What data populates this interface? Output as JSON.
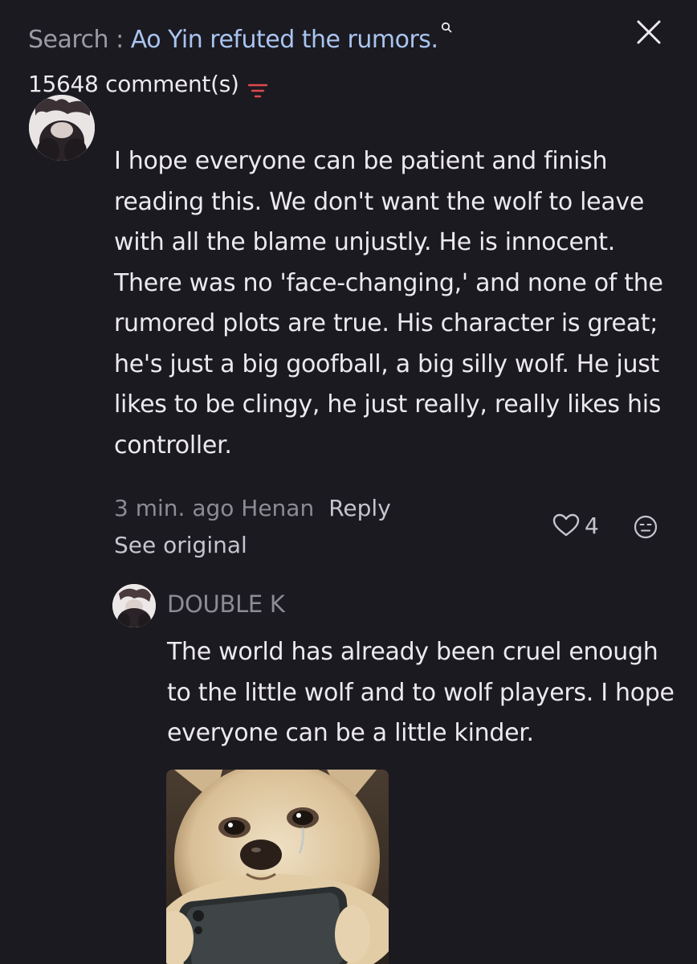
{
  "header": {
    "search_prefix": "Search : ",
    "search_query": "Ao Yin refuted the rumors.",
    "search_icon": "magnifier-icon",
    "close_icon": "close-icon"
  },
  "comments": {
    "count_label": "15648 comment(s)",
    "sort_icon": "filter-sort-icon",
    "accent_color": "#e0484f"
  },
  "comment": {
    "avatar": "user-avatar",
    "text": "I hope everyone can be patient and finish reading this. We don't want the wolf to leave with all the blame unjustly. He is innocent. There was no 'face-changing,' and none of the rumored plots are true. His character is great; he's just a big goofball, a big silly wolf. He just likes to be clingy, he just really, really likes his controller.",
    "time_location": "3 min. ago Henan",
    "reply_label": "Reply",
    "see_original_label": "See original",
    "like_icon": "heart-outline-icon",
    "like_count": "4",
    "reaction_icon": "emoji-face-icon"
  },
  "reply": {
    "avatar": "user-avatar",
    "author": "DOUBLE K",
    "text": "The world has already been cruel enough to the little wolf and to wolf players. I hope everyone can be a little kinder.",
    "image": "crying-dog-holding-phone-image"
  },
  "colors": {
    "background": "#1b1a20",
    "text": "#eceaf0",
    "muted": "#8d8b93",
    "link": "#a9c4f0"
  }
}
